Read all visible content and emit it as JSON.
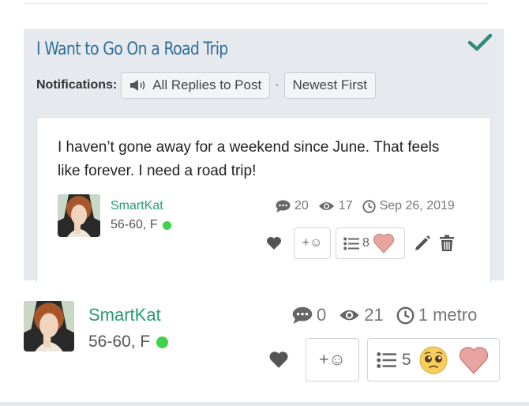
{
  "thread": {
    "title": "I Want to Go On a Road Trip",
    "notifications_label": "Notifications:",
    "replies_option": "All Replies to Post",
    "separator": "·",
    "sort_option": "Newest First"
  },
  "post": {
    "text": "I haven’t gone away for a weekend since June. That feels like forever. I need a road trip!",
    "author": "SmartKat",
    "meta": "56-60, F",
    "comments": "20",
    "views": "17",
    "date": "Sep 26, 2019",
    "add_reaction": "+☺",
    "reaction_count": "8"
  },
  "reply": {
    "author": "SmartKat",
    "meta": "56-60, F",
    "comments": "0",
    "views": "21",
    "time": "1 metro",
    "add_reaction": "+☺",
    "reaction_count": "5"
  },
  "colors": {
    "title_blue": "#2f6f9a",
    "author_green": "#2a9a6e",
    "online_green": "#3fd14a",
    "check_teal": "#2e8b7a",
    "card_bg": "#e6eaee"
  },
  "icons": [
    "check-icon",
    "megaphone-icon",
    "comment-icon",
    "eye-icon",
    "clock-icon",
    "heart-icon",
    "list-icon",
    "pink-heart-icon",
    "pleading-face-icon",
    "pencil-icon",
    "trash-icon"
  ]
}
